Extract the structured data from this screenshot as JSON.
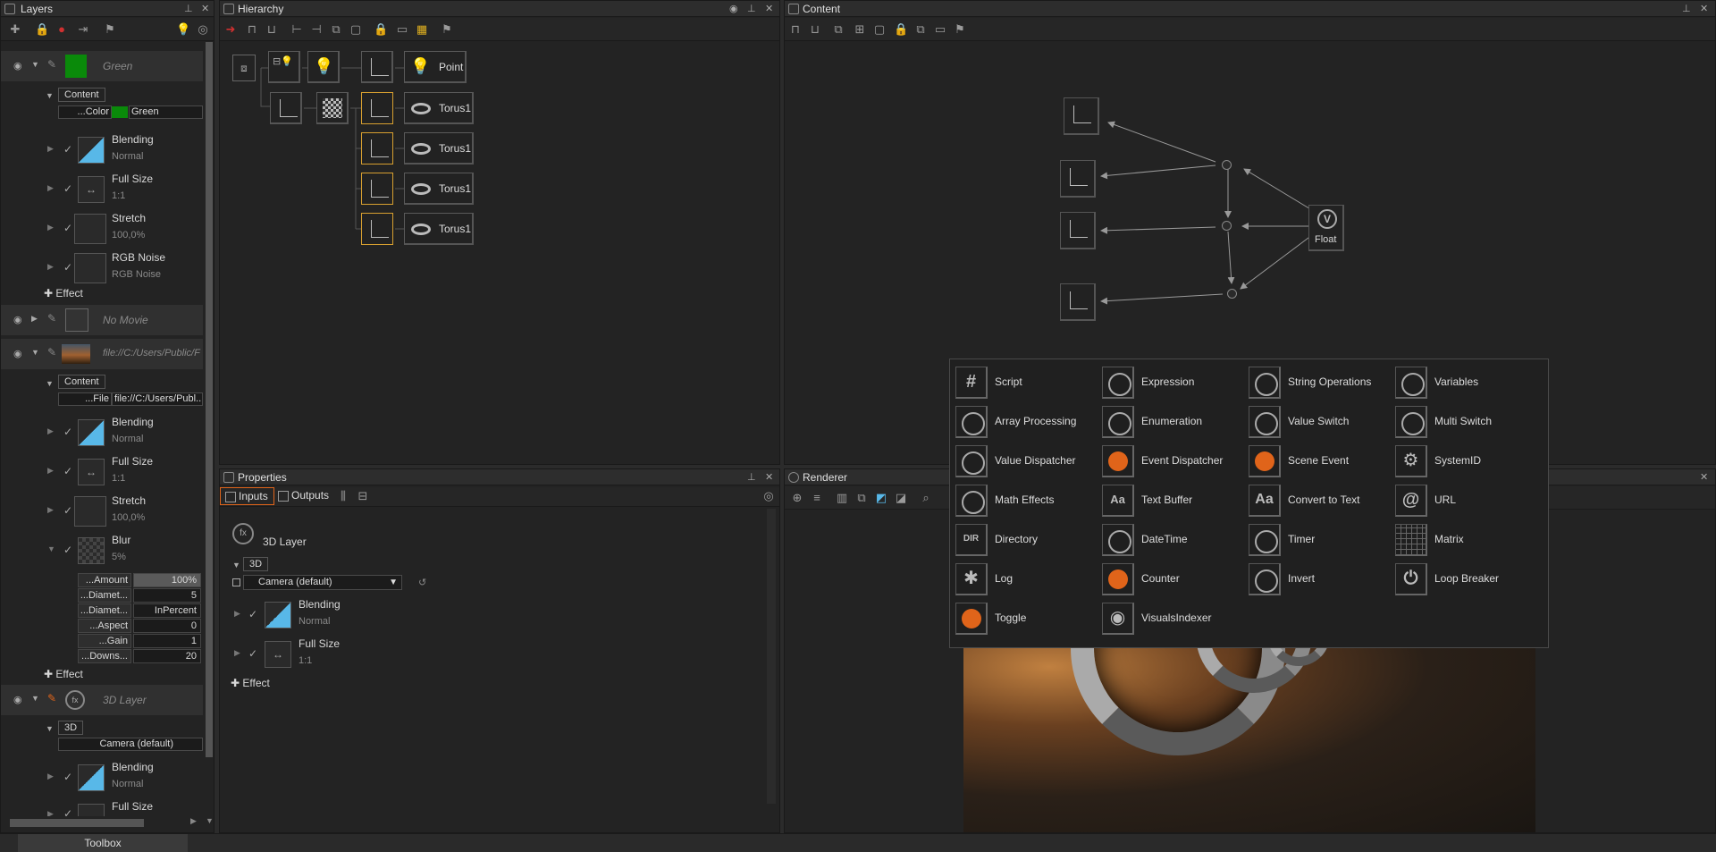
{
  "layers_panel": {
    "title": "Layers",
    "layers": [
      {
        "name": "Green",
        "content_label": "Content",
        "color_key": "...Color",
        "color_value": "Green"
      },
      {
        "name": "No Movie"
      },
      {
        "name": "file://C:/Users/Public/F",
        "content_label": "Content",
        "file_key": "...File",
        "file_value": "file://C:/Users/Publ..."
      },
      {
        "name": "3D Layer",
        "content_label": "3D",
        "camera_value": "Camera (default)"
      }
    ],
    "effects_green": [
      {
        "name": "Blending",
        "sub": "Normal"
      },
      {
        "name": "Full Size",
        "sub": "1:1"
      },
      {
        "name": "Stretch",
        "sub": "100,0%"
      },
      {
        "name": "RGB Noise",
        "sub": "RGB Noise"
      }
    ],
    "effects_file": [
      {
        "name": "Blending",
        "sub": "Normal"
      },
      {
        "name": "Full Size",
        "sub": "1:1"
      },
      {
        "name": "Stretch",
        "sub": "100,0%"
      },
      {
        "name": "Blur",
        "sub": "5%"
      }
    ],
    "blur_props": [
      {
        "k": "...Amount",
        "v": "100%"
      },
      {
        "k": "...Diamet...",
        "v": "5"
      },
      {
        "k": "...Diamet...",
        "v": "InPercent"
      },
      {
        "k": "...Aspect",
        "v": "0"
      },
      {
        "k": "...Gain",
        "v": "1"
      },
      {
        "k": "...Downs...",
        "v": "20"
      }
    ],
    "effects_3d": [
      {
        "name": "Blending",
        "sub": "Normal"
      },
      {
        "name": "Full Size",
        "sub": ""
      }
    ],
    "add_effect": "Effect"
  },
  "hierarchy_panel": {
    "title": "Hierarchy",
    "point_label": "Point",
    "torus_labels": [
      "Torus1",
      "Torus1",
      "Torus1",
      "Torus1"
    ]
  },
  "content_panel": {
    "title": "Content",
    "float_label": "Float"
  },
  "properties_panel": {
    "title": "Properties",
    "tab_inputs": "Inputs",
    "tab_outputs": "Outputs",
    "layer_name": "3D Layer",
    "group_label": "3D",
    "camera_value": "Camera (default)",
    "effects": [
      {
        "name": "Blending",
        "sub": "Normal"
      },
      {
        "name": "Full Size",
        "sub": "1:1"
      }
    ],
    "add_effect": "Effect"
  },
  "renderer_panel": {
    "title": "Renderer"
  },
  "popup_menu": {
    "columns": [
      [
        "Script",
        "Array Processing",
        "Value Dispatcher",
        "Math Effects",
        "Directory",
        "Log",
        "Toggle"
      ],
      [
        "Expression",
        "Enumeration",
        "Event Dispatcher",
        "Text Buffer",
        "DateTime",
        "Counter",
        "VisualsIndexer"
      ],
      [
        "String Operations",
        "Value Switch",
        "Scene Event",
        "Convert to Text",
        "Timer",
        "Invert"
      ],
      [
        "Variables",
        "Multi Switch",
        "SystemID",
        "URL",
        "Matrix",
        "Loop Breaker"
      ]
    ]
  },
  "bottom_bar": {
    "toolbox_tab": "Toolbox"
  },
  "colors": {
    "accent_orange": "#e0641a",
    "selection_border": "#d8a030",
    "green_swatch": "#0a8a0a"
  }
}
